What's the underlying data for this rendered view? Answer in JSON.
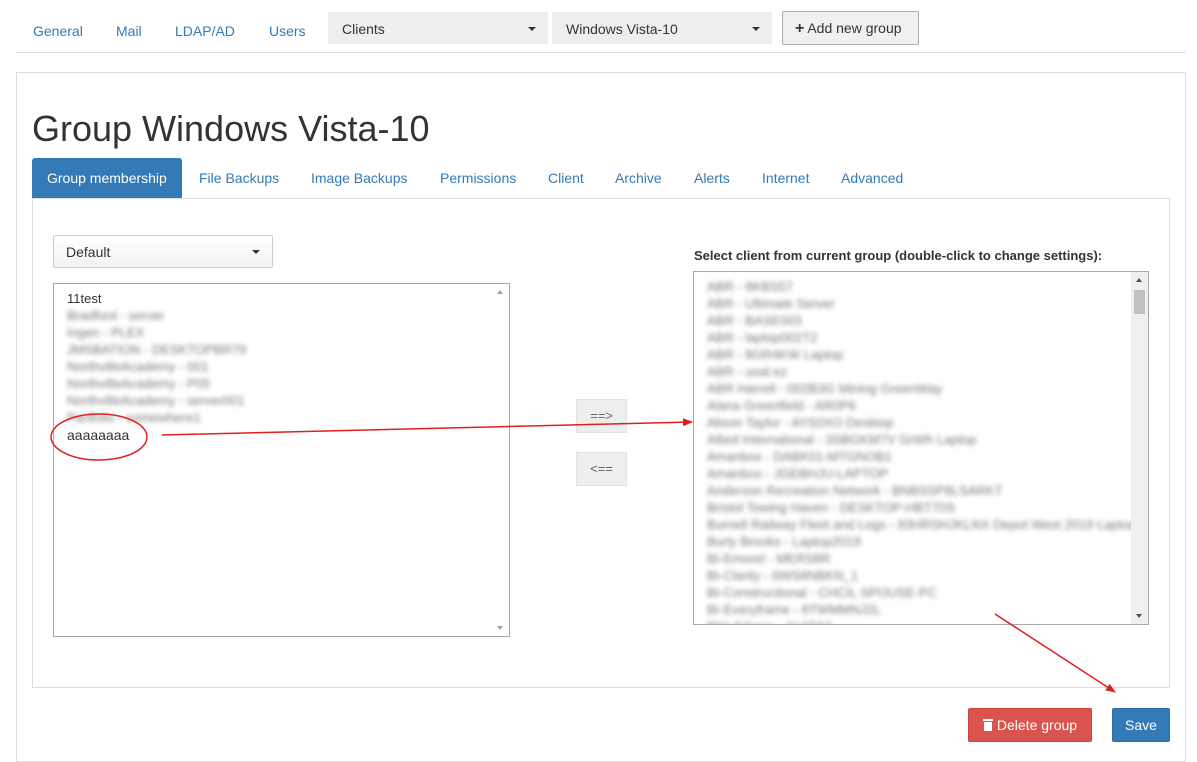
{
  "nav": {
    "links": [
      "General",
      "Mail",
      "LDAP/AD",
      "Users"
    ],
    "type_select": "Clients",
    "group_select": "Windows Vista-10",
    "add_group_label": "Add new group"
  },
  "page": {
    "title": "Group Windows Vista-10"
  },
  "tabs": [
    "Group membership",
    "File Backups",
    "Image Backups",
    "Permissions",
    "Client",
    "Archive",
    "Alerts",
    "Internet",
    "Advanced"
  ],
  "membership": {
    "source_group": "Default",
    "source_clients": [
      "11test",
      "Bradford - server",
      "Ingen - PLEX",
      "JMSBATION - DESKTOPBR79",
      "NorthvilleAcademy - 001",
      "NorthvilleAcademy - P05",
      "NorthvilleAcademy - server001",
      "Partfolio - somewhere1",
      "aaaaaaaa"
    ],
    "add_button": "==>",
    "remove_button": "<==",
    "target_label": "Select client from current group (double-click to change settings):",
    "target_clients": [
      "ABR - 8KBS57",
      "ABR - Ultimate Server",
      "ABR - BASE003",
      "ABR - laptop002T2",
      "ABR - 8GR4KW Laptop",
      "ABR - uoal.ez",
      "ABR Harrell - 002B3G Mining GreenWay",
      "Alana Greenfield - AR0P6",
      "Alison Taylor - AYS0XO Desktop",
      "Allied International - 3SBGKM7V GrWh Laptop",
      "Amanbox - DABK01-MTGNOB1",
      "Amanbox - JGEBHJU-LAPTOP",
      "Anderson Recreation Network - BNBSSP8LSARKT",
      "Bristol Towing Haven - DESKTOP-HBT70S",
      "Burnell Railway Fleet and Logs - 83HRSHJKLNX Depot West 2019 Laptop",
      "Burly Brooks - Laptop2019",
      "BI-Emorel - MERS8R",
      "BI-Clarity - 6WS8NBKN_1",
      "BI-Constructional - CHCIL SPOUSE-PC",
      "BI-Everyframe - 8TWMMNJ2L",
      "BNI-Gibson - CUITS2"
    ]
  },
  "actions": {
    "delete_label": "Delete group",
    "save_label": "Save"
  },
  "colors": {
    "primary": "#337ab7",
    "danger": "#d9534f",
    "annotation": "#e02020"
  }
}
